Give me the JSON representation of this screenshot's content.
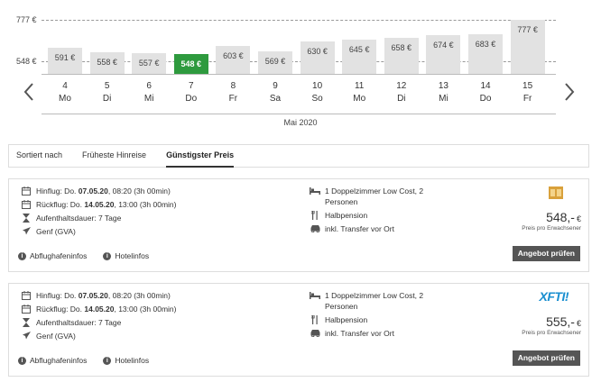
{
  "chart_data": {
    "type": "bar",
    "y_ticks": [
      "777 €",
      "548 €"
    ],
    "y_tick_values": [
      777,
      548
    ],
    "ylim": [
      500,
      777
    ],
    "bars": [
      {
        "day": "4",
        "dow": "Mo",
        "value": 591,
        "label": "591 €"
      },
      {
        "day": "5",
        "dow": "Di",
        "value": 558,
        "label": "558 €"
      },
      {
        "day": "6",
        "dow": "Mi",
        "value": 557,
        "label": "557 €"
      },
      {
        "day": "7",
        "dow": "Do",
        "value": 548,
        "label": "548 €",
        "selected": true
      },
      {
        "day": "8",
        "dow": "Fr",
        "value": 603,
        "label": "603 €"
      },
      {
        "day": "9",
        "dow": "Sa",
        "value": 569,
        "label": "569 €"
      },
      {
        "day": "10",
        "dow": "So",
        "value": 630,
        "label": "630 €"
      },
      {
        "day": "11",
        "dow": "Mo",
        "value": 645,
        "label": "645 €"
      },
      {
        "day": "12",
        "dow": "Di",
        "value": 658,
        "label": "658 €"
      },
      {
        "day": "13",
        "dow": "Mi",
        "value": 674,
        "label": "674 €"
      },
      {
        "day": "14",
        "dow": "Do",
        "value": 683,
        "label": "683 €"
      },
      {
        "day": "15",
        "dow": "Fr",
        "value": 777,
        "label": "777 €"
      }
    ],
    "month_label": "Mai 2020",
    "selected_color": "#2e9a3e",
    "bar_color": "#e2e2e2"
  },
  "sort": {
    "label": "Sortiert nach",
    "options": [
      "Früheste Hinreise",
      "Günstigster Preis"
    ],
    "active": "Günstigster Preis"
  },
  "offers": [
    {
      "outbound_prefix": "Hinflug: Do. ",
      "outbound_date": "07.05.20",
      "outbound_suffix": ", 08:20 (3h 00min)",
      "return_prefix": "Rückflug: Do. ",
      "return_date": "14.05.20",
      "return_suffix": ", 13:00 (3h 00min)",
      "stay": "Aufenthaltsdauer: 7 Tage",
      "airport": "Genf (GVA)",
      "room": "1 Doppelzimmer Low Cost, 2 Personen",
      "board": "Halbpension",
      "transfer": "inkl. Transfer vor Ort",
      "price": "548,-",
      "currency": "€",
      "price_note": "Preis pro Erwachsener",
      "button": "Angebot prüfen",
      "link_airport": "Abflughafeninfos",
      "link_hotel": "Hotelinfos",
      "logo": "tour-operator-logo-icon"
    },
    {
      "outbound_prefix": "Hinflug: Do. ",
      "outbound_date": "07.05.20",
      "outbound_suffix": ", 08:20 (3h 00min)",
      "return_prefix": "Rückflug: Do. ",
      "return_date": "14.05.20",
      "return_suffix": ", 13:00 (3h 00min)",
      "stay": "Aufenthaltsdauer: 7 Tage",
      "airport": "Genf (GVA)",
      "room": "1 Doppelzimmer Low Cost, 2 Personen",
      "board": "Halbpension",
      "transfer": "inkl. Transfer vor Ort",
      "price": "555,-",
      "currency": "€",
      "price_note": "Preis pro Erwachsener",
      "button": "Angebot prüfen",
      "link_airport": "Abflughafeninfos",
      "link_hotel": "Hotelinfos",
      "logo": "XFTI!"
    }
  ]
}
